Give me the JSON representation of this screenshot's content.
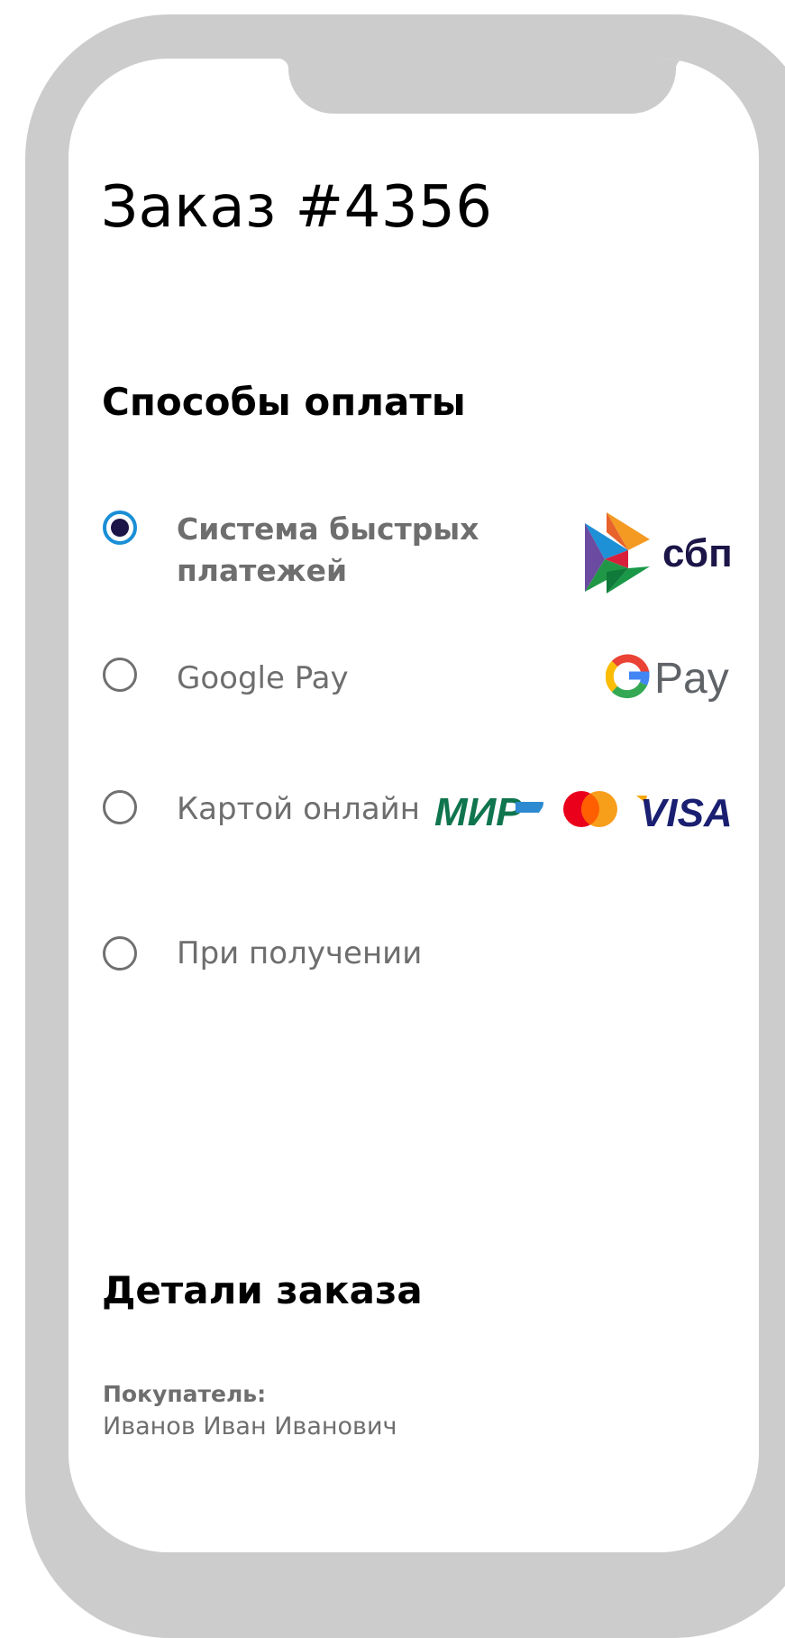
{
  "order": {
    "title": "Заказ #4356"
  },
  "payment": {
    "section_title": "Способы оплаты",
    "options": [
      {
        "label_line1": "Система быстрых",
        "label_line2": "платежей",
        "selected": true,
        "logo": "sbp-logo",
        "logo_text": "сбп"
      },
      {
        "label": "Google Pay",
        "selected": false,
        "logo": "google-pay-logo",
        "logo_text": "Pay"
      },
      {
        "label": "Картой онлайн",
        "selected": false,
        "logos": [
          "mir-logo",
          "mastercard-logo",
          "visa-logo"
        ],
        "mir_text": "МИР",
        "visa_text": "VISA"
      },
      {
        "label": "При получении",
        "selected": false
      }
    ]
  },
  "details": {
    "section_title": "Детали заказа",
    "buyer_label": "Покупатель:",
    "buyer_name": "Иванов Иван Иванович"
  },
  "colors": {
    "frame": "#cccccc",
    "radio_selected_ring": "#1a8fd6",
    "radio_selected_dot": "#1b1548",
    "text_muted": "#6e6e6e",
    "mir_green": "#0f754e",
    "visa_blue": "#1a1f71"
  }
}
